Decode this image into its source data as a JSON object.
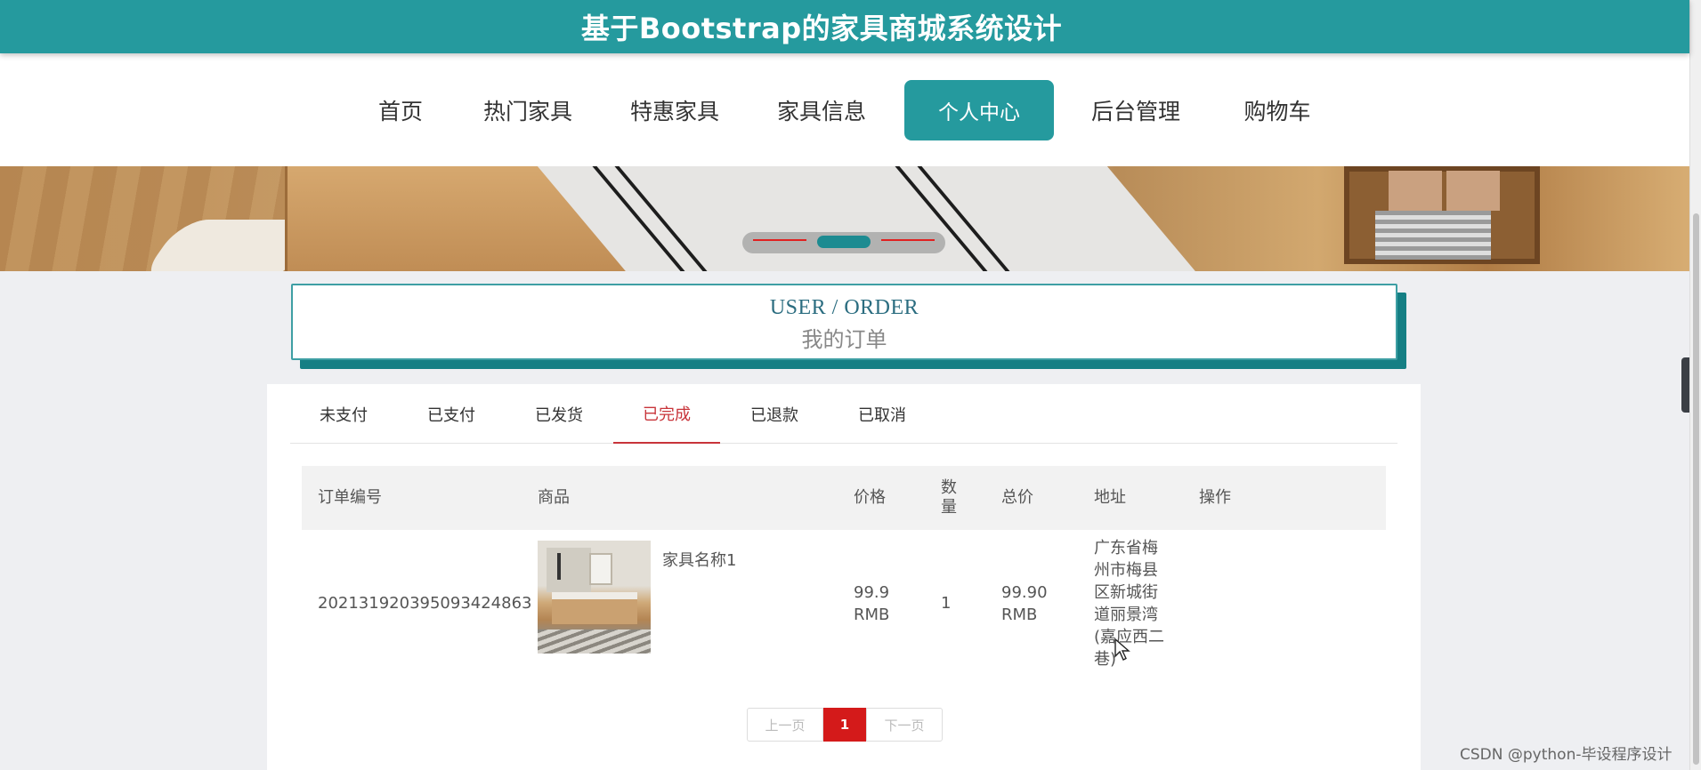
{
  "app": {
    "title": "基于Bootstrap的家具商城系统设计"
  },
  "nav": {
    "items": [
      {
        "label": "首页"
      },
      {
        "label": "热门家具"
      },
      {
        "label": "特惠家具"
      },
      {
        "label": "家具信息"
      },
      {
        "label": "个人中心",
        "active": true
      },
      {
        "label": "后台管理"
      },
      {
        "label": "购物车"
      }
    ]
  },
  "banner": {
    "slides_total": 3,
    "active_slide": 2
  },
  "section": {
    "title_en": "USER / ORDER",
    "title_cn": "我的订单"
  },
  "tabs": [
    {
      "label": "未支付"
    },
    {
      "label": "已支付"
    },
    {
      "label": "已发货"
    },
    {
      "label": "已完成",
      "active": true
    },
    {
      "label": "已退款"
    },
    {
      "label": "已取消"
    }
  ],
  "table": {
    "headers": {
      "order_no": "订单编号",
      "product": "商品",
      "price": "价格",
      "qty_line1": "数",
      "qty_line2": "量",
      "total": "总价",
      "address": "地址",
      "action": "操作"
    },
    "rows": [
      {
        "order_no": "202131920395093424863",
        "product_name": "家具名称1",
        "price_value": "99.9",
        "price_unit": "RMB",
        "qty": "1",
        "total_value": "99.90",
        "total_unit": "RMB",
        "address_lines": [
          "广东省梅",
          "州市梅县",
          "区新城街",
          "道丽景湾",
          "(嘉应西二",
          "巷)"
        ]
      }
    ]
  },
  "pagination": {
    "prev": "上一页",
    "current": "1",
    "next": "下一页"
  },
  "watermark": "CSDN @python-毕设程序设计",
  "colors": {
    "primary": "#259a9e",
    "active_tab": "#c8343a",
    "page_current": "#d41a1a"
  }
}
